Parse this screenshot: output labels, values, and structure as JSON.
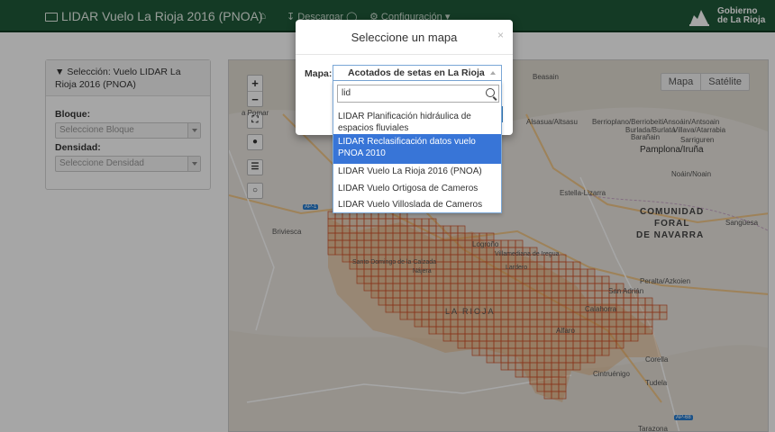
{
  "navbar": {
    "title": "LIDAR Vuelo La Rioja 2016 (PNOA)",
    "home_icon": "home-icon",
    "download_label": "Descargar",
    "config_label": "Configuración",
    "logo_text_line1": "Gobierno",
    "logo_text_line2": "de La Rioja",
    "bg_color": "#1f5a3a"
  },
  "sidebar": {
    "heading": "Selección: Vuelo LIDAR La Rioja 2016 (PNOA)",
    "bloque_label": "Bloque:",
    "bloque_placeholder": "Seleccione Bloque",
    "densidad_label": "Densidad:",
    "densidad_placeholder": "Seleccione Densidad"
  },
  "map": {
    "controls": [
      "+",
      "−"
    ],
    "type_buttons": [
      "Mapa",
      "Satélite"
    ],
    "grid_color": "#d1502a",
    "labels": {
      "beasain": "Beasain",
      "alsasua": "Alsasua/Altsasu",
      "berriop": "Berrioplano/Berriobeiti",
      "ansoain": "Ansoáin/Antsoain",
      "burlada": "Burlada/Burlata",
      "villava": "Villava/Atarrabia",
      "baranain": "Barañain",
      "sarriguren": "Sarriguren",
      "pamplona": "Pamplona/Iruña",
      "noain": "Noáin/Noain",
      "estella": "Estella-Lizarra",
      "comunidad1": "COMUNIDAD",
      "comunidad2": "FORAL",
      "comunidad3": "DE NAVARRA",
      "sanguesa": "Sangüesa",
      "briviesca": "Briviesca",
      "larioja": "LA RIOJA",
      "logrono": "Logroño",
      "lardero": "Lardero",
      "villamediana": "Villamediana de Iregua",
      "santodomingo": "Santo Domingo de la Calzada",
      "najera": "Nájera",
      "sanadrian": "San Adrián",
      "peralta": "Peralta/Azkoien",
      "calahorra": "Calahorra",
      "alfaro": "Alfaro",
      "corella": "Corella",
      "cintruenigo": "Cintruénigo",
      "tudela": "Tudela",
      "tarazona": "Tarazona",
      "pomar": "a Pomar",
      "ap1": "AP-1",
      "ap68": "AP-68"
    }
  },
  "modal": {
    "title": "Seleccione un mapa",
    "close": "×",
    "mapa_label": "Mapa:",
    "selected": "Acotados de setas en La Rioja",
    "search_value": "lid",
    "options": [
      {
        "label": "LIDAR Planificación hidráulica de espacios fluviales",
        "active": false
      },
      {
        "label": "LIDAR Reclasificación datos vuelo PNOA 2010",
        "active": true
      },
      {
        "label": "LIDAR Vuelo La Rioja 2016 (PNOA)",
        "active": false
      },
      {
        "label": "LIDAR Vuelo Ortigosa de Cameros",
        "active": false
      },
      {
        "label": "LIDAR Vuelo Villoslada de Cameros",
        "active": false
      }
    ]
  }
}
